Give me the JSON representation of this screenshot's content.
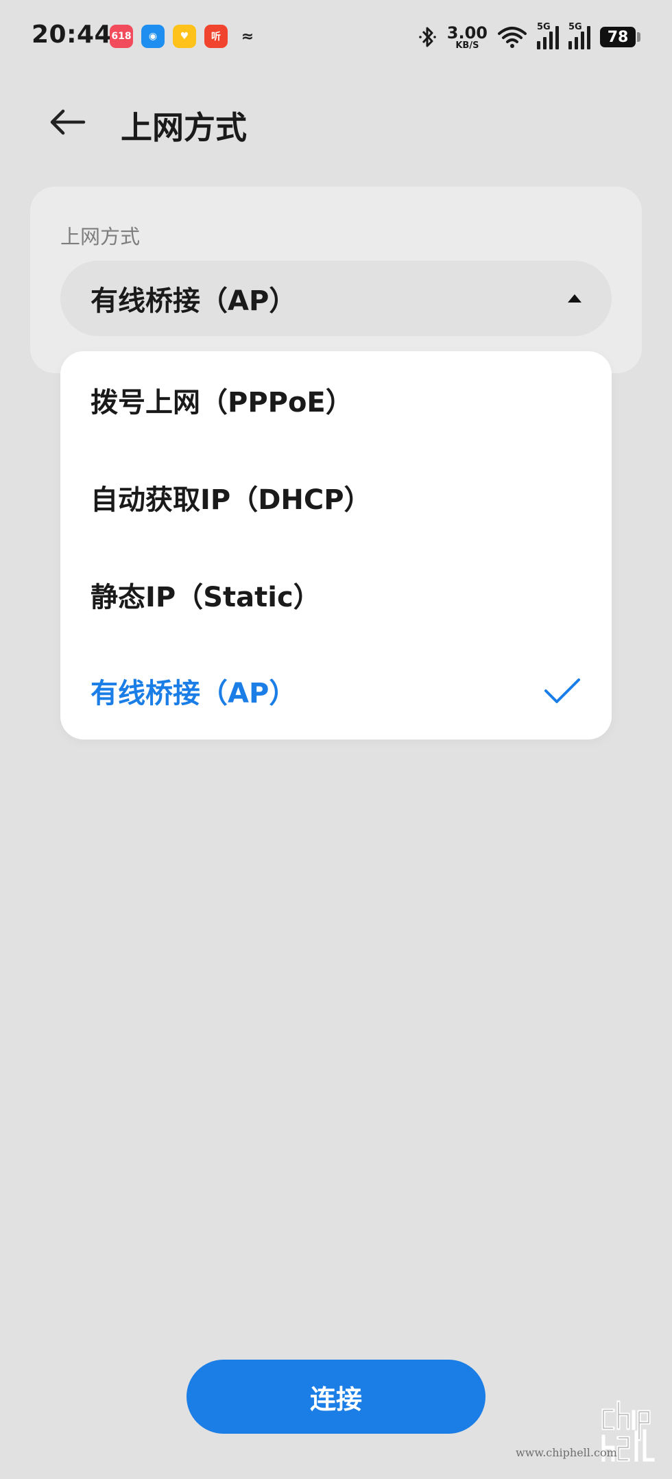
{
  "status_bar": {
    "time": "20:44",
    "notification_icons": [
      {
        "name": "618-app-icon",
        "glyph": "618",
        "color": "#f24b5b"
      },
      {
        "name": "assistant-app-icon",
        "glyph": "◉",
        "color": "#1e8ef0"
      },
      {
        "name": "heart-app-icon",
        "glyph": "♥",
        "color": "#ffc21a"
      },
      {
        "name": "listen-app-icon",
        "glyph": "听",
        "color": "#f0442e"
      },
      {
        "name": "misc-app-icon",
        "glyph": "≈",
        "color": "transparent"
      }
    ],
    "speed_value": "3.00",
    "speed_unit": "KB/S",
    "sim1_label": "5G",
    "sim2_label": "5G",
    "battery": "78"
  },
  "header": {
    "title": "上网方式"
  },
  "form": {
    "field_label": "上网方式",
    "selected_value": "有线桥接（AP）"
  },
  "dropdown": {
    "options": [
      {
        "label": "拨号上网（PPPoE）",
        "selected": false
      },
      {
        "label": "自动获取IP（DHCP）",
        "selected": false
      },
      {
        "label": "静态IP（Static）",
        "selected": false
      },
      {
        "label": "有线桥接（AP）",
        "selected": true
      }
    ]
  },
  "actions": {
    "connect_label": "连接"
  },
  "watermark": {
    "url": "www.chiphell.com"
  },
  "colors": {
    "accent": "#1a7ee6",
    "background": "#e1e1e1",
    "card": "#ebebeb",
    "dropdown": "#ffffff"
  }
}
